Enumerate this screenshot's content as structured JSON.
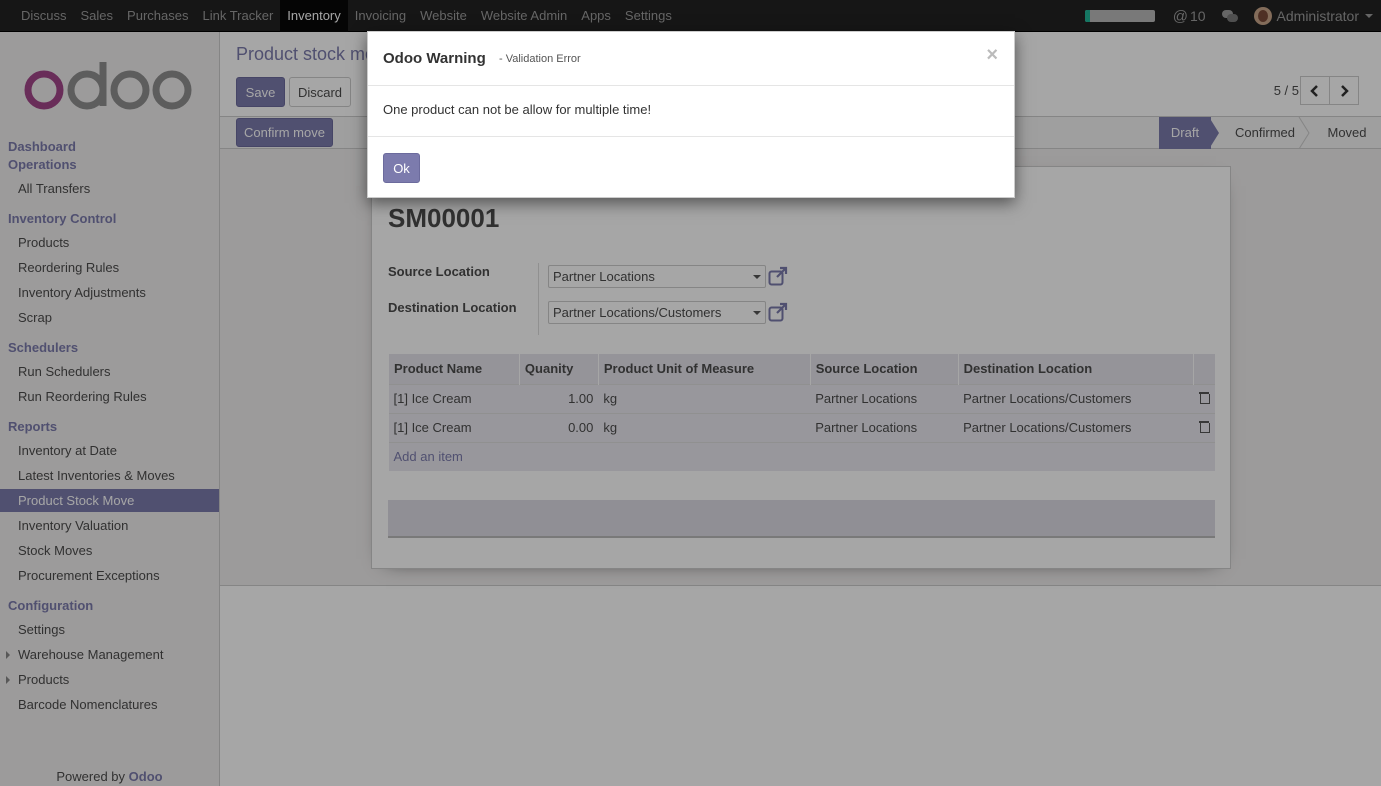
{
  "topbar": {
    "menu": [
      {
        "label": "Discuss",
        "active": false
      },
      {
        "label": "Sales",
        "active": false
      },
      {
        "label": "Purchases",
        "active": false
      },
      {
        "label": "Link Tracker",
        "active": false
      },
      {
        "label": "Inventory",
        "active": true
      },
      {
        "label": "Invoicing",
        "active": false
      },
      {
        "label": "Website",
        "active": false
      },
      {
        "label": "Website Admin",
        "active": false
      },
      {
        "label": "Apps",
        "active": false
      },
      {
        "label": "Settings",
        "active": false
      }
    ],
    "mention_symbol": "@",
    "mention_count": "10",
    "user_name": "Administrator",
    "progress_fraction": 0.08,
    "progress_color": "#21b799"
  },
  "sidebar": {
    "sections": [
      {
        "heading": "Dashboard"
      },
      {
        "heading": "Operations",
        "items": [
          "All Transfers"
        ]
      },
      {
        "heading": "Inventory Control",
        "items": [
          "Products",
          "Reordering Rules",
          "Inventory Adjustments",
          "Scrap"
        ]
      },
      {
        "heading": "Schedulers",
        "items": [
          "Run Schedulers",
          "Run Reordering Rules"
        ]
      },
      {
        "heading": "Reports",
        "items": [
          "Inventory at Date",
          "Latest Inventories & Moves",
          "Product Stock Move",
          "Inventory Valuation",
          "Stock Moves",
          "Procurement Exceptions"
        ]
      },
      {
        "heading": "Configuration",
        "items": [
          "Settings",
          "Warehouse Management",
          "Products",
          "Barcode Nomenclatures"
        ]
      }
    ],
    "active_item": "Product Stock Move",
    "powered_by": "Powered by",
    "powered_brand": "Odoo",
    "accent": "#7c7bad"
  },
  "control_panel": {
    "breadcrumb": "Product stock mo",
    "save_label": "Save",
    "discard_label": "Discard",
    "pager": "5 / 5"
  },
  "statusbar": {
    "action_label": "Confirm move",
    "stages": [
      "Draft",
      "Confirmed",
      "Moved"
    ],
    "current_stage": "Draft"
  },
  "form": {
    "record_name": "SM00001",
    "source_location_label": "Source Location",
    "source_location_value": "Partner Locations",
    "destination_location_label": "Destination Location",
    "destination_location_value": "Partner Locations/Customers",
    "columns": [
      "Product Name",
      "Quanity",
      "Product Unit of Measure",
      "Source Location",
      "Destination Location"
    ],
    "rows": [
      {
        "product": "[1] Ice Cream",
        "qty": "1.00",
        "uom": "kg",
        "src": "Partner Locations",
        "dst": "Partner Locations/Customers"
      },
      {
        "product": "[1] Ice Cream",
        "qty": "0.00",
        "uom": "kg",
        "src": "Partner Locations",
        "dst": "Partner Locations/Customers"
      }
    ],
    "add_item_label": "Add an item"
  },
  "dialog": {
    "title": "Odoo Warning",
    "subtitle": "- Validation Error",
    "close_symbol": "×",
    "message": "One product can not be allow for multiple time!",
    "ok_label": "Ok"
  }
}
